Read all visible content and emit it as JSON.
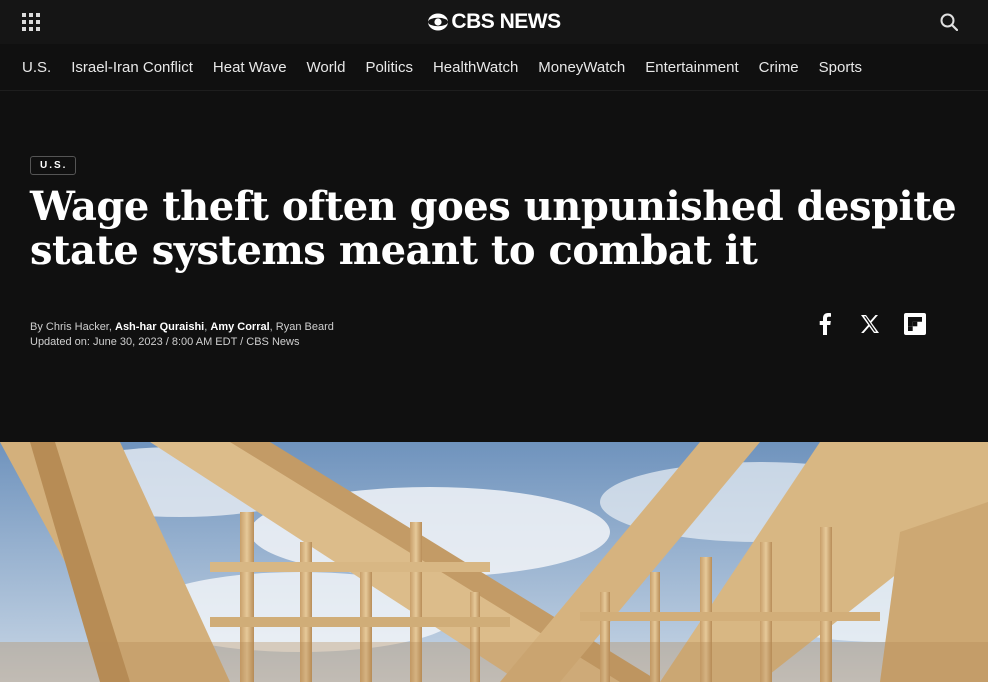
{
  "header": {
    "logo_text": "CBS NEWS",
    "apps_icon": "grid-icon",
    "search_icon": "search-icon"
  },
  "nav": {
    "items": [
      "U.S.",
      "Israel-Iran Conflict",
      "Heat Wave",
      "World",
      "Politics",
      "HealthWatch",
      "MoneyWatch",
      "Entertainment",
      "Crime",
      "Sports"
    ]
  },
  "article": {
    "section": "U.S.",
    "headline": "Wage theft often goes unpunished despite state systems meant to combat it",
    "byline": {
      "prefix": "By ",
      "authors": [
        "Chris Hacker",
        "Ash-har Quraishi",
        "Amy Corral",
        "Ryan Beard"
      ],
      "sep": ", ",
      "updated": "Updated on: June 30, 2023 / 8:00 AM EDT / CBS News"
    }
  },
  "share": {
    "icons": [
      "facebook-icon",
      "x-icon",
      "flipboard-icon"
    ]
  },
  "colors": {
    "background": "#101010",
    "topbar": "#151515",
    "text": "#ffffff",
    "sky": "#8fb2d6",
    "wood": "#d9b98a"
  }
}
